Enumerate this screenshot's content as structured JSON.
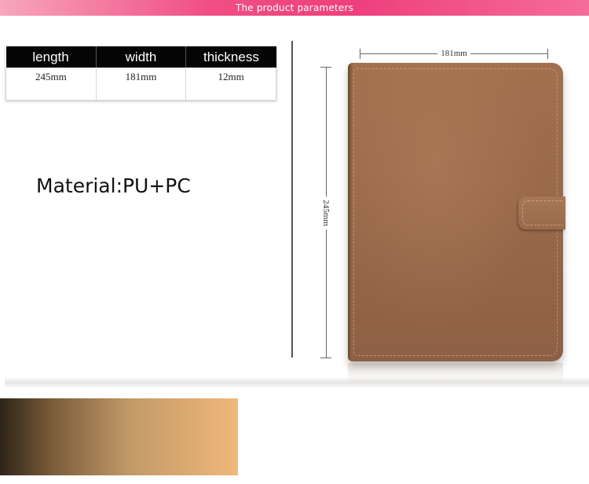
{
  "banner": {
    "title": "The product parameters"
  },
  "specs": {
    "headers": [
      "length",
      "width",
      "thickness"
    ],
    "values": [
      "245mm",
      "181mm",
      "12mm"
    ]
  },
  "material": {
    "text": "Material:PU+PC"
  },
  "product": {
    "width_label": "181mm",
    "height_label": "245mm",
    "color": "#99684a"
  },
  "colors": {
    "banner": "#ee3f7c",
    "table_header": "#050505"
  }
}
